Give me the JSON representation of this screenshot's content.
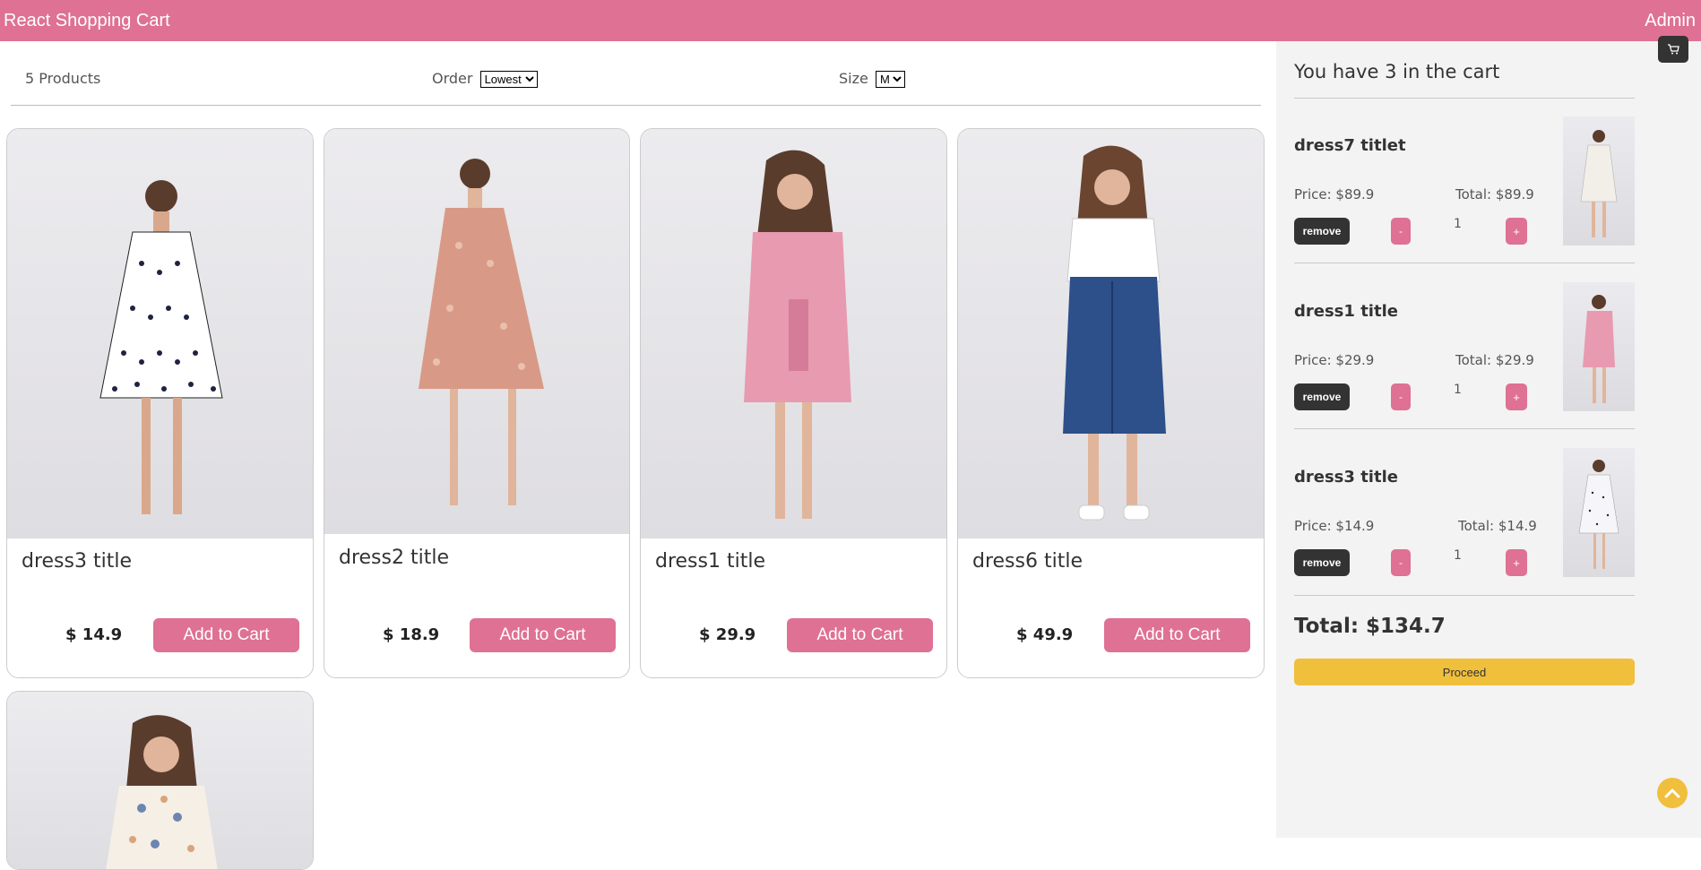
{
  "header": {
    "brand": "React Shopping Cart",
    "admin": "Admin"
  },
  "filter": {
    "count": "5 Products",
    "order_label": "Order",
    "order_value": "Lowest",
    "size_label": "Size",
    "size_value": "M"
  },
  "products": [
    {
      "title": "dress3 title",
      "price": "$ 14.9",
      "button": "Add to Cart"
    },
    {
      "title": "dress2 title",
      "price": "$ 18.9",
      "button": "Add to Cart"
    },
    {
      "title": "dress1 title",
      "price": "$ 29.9",
      "button": "Add to Cart"
    },
    {
      "title": "dress6 title",
      "price": "$ 49.9",
      "button": "Add to Cart"
    },
    {
      "title": "",
      "price": "",
      "button": ""
    }
  ],
  "cart": {
    "title": "You have 3 in the cart",
    "items": [
      {
        "name": "dress7 titlet",
        "price": "Price: $89.9",
        "total": "Total: $89.9",
        "qty": "1",
        "remove": "remove",
        "minus": "-",
        "plus": "+"
      },
      {
        "name": "dress1 title",
        "price": "Price: $29.9",
        "total": "Total: $29.9",
        "qty": "1",
        "remove": "remove",
        "minus": "-",
        "plus": "+"
      },
      {
        "name": "dress3 title",
        "price": "Price: $14.9",
        "total": "Total: $14.9",
        "qty": "1",
        "remove": "remove",
        "minus": "-",
        "plus": "+"
      }
    ],
    "grand_total": "Total: $134.7",
    "proceed": "Proceed"
  },
  "colors": {
    "accent": "#de7194",
    "button_dark": "#333333",
    "proceed": "#f0bf3c"
  },
  "icons": {
    "cart": "cart-icon",
    "scroll_top": "chevron-up-icon"
  }
}
